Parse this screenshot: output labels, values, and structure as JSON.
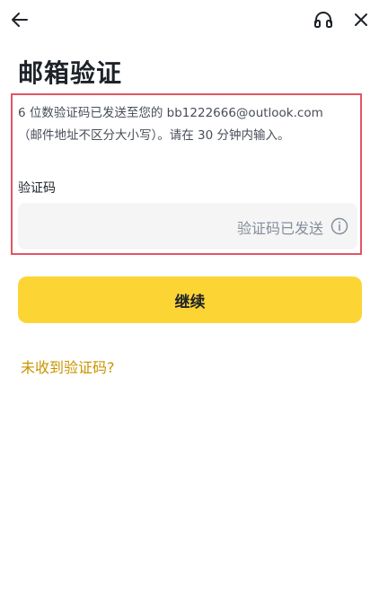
{
  "header": {
    "back_icon": "arrow-left-icon",
    "support_icon": "headset-icon",
    "close_icon": "close-icon"
  },
  "page": {
    "title": "邮箱验证"
  },
  "verification": {
    "description_line1": "6 位数验证码已发送至您的 bb1222666@outlook.com",
    "description_line2": "（邮件地址不区分大小写）。请在 30 分钟内输入。",
    "field_label": "验证码",
    "input_value": "",
    "input_placeholder": "",
    "sent_status": "验证码已发送",
    "info_icon": "info-circle-icon"
  },
  "actions": {
    "continue_label": "继续",
    "resend_link_label": "未收到验证码?"
  },
  "colors": {
    "accent": "#fcd535",
    "link": "#c99400",
    "highlight_border": "#e25563"
  }
}
